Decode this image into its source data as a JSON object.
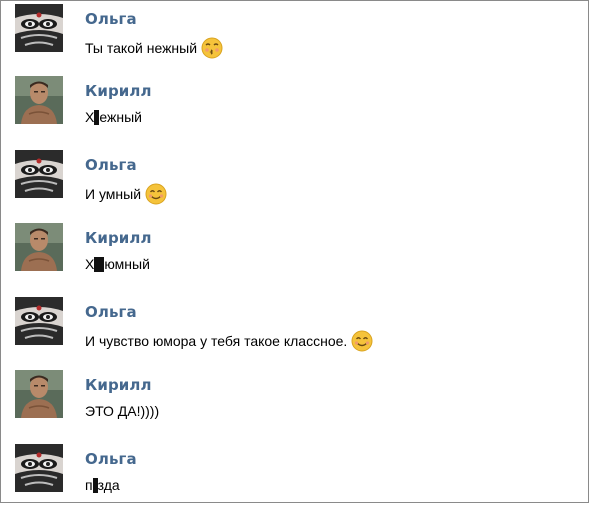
{
  "messages": [
    {
      "author": "Ольга",
      "avatar": "olga-face-avatar",
      "parts": [
        "Ты такой нежный"
      ],
      "emoji": "kissing-emoji"
    },
    {
      "author": "Кирилл",
      "avatar": "kirill-photo-avatar",
      "parts": [
        "Х",
        "ежный"
      ],
      "censor": "narrow"
    },
    {
      "author": "Ольга",
      "avatar": "olga-face-avatar",
      "parts": [
        "И умный"
      ],
      "emoji": "smile-emoji"
    },
    {
      "author": "Кирилл",
      "avatar": "kirill-photo-avatar",
      "parts": [
        "Х",
        "юмный"
      ],
      "censor": "wide"
    },
    {
      "author": "Ольга",
      "avatar": "olga-face-avatar",
      "parts": [
        "И чувство юмора у тебя такое классное."
      ],
      "emoji": "smile-emoji"
    },
    {
      "author": "Кирилл",
      "avatar": "kirill-photo-avatar",
      "parts": [
        "ЭТО ДА!))))"
      ]
    },
    {
      "author": "Ольга",
      "avatar": "olga-face-avatar",
      "parts": [
        "п",
        "зда"
      ],
      "censor": "narrow"
    }
  ],
  "colors": {
    "author": "#45688e",
    "text": "#000000",
    "emoji": "#f5c33b",
    "frame": "#8a8a8a"
  }
}
